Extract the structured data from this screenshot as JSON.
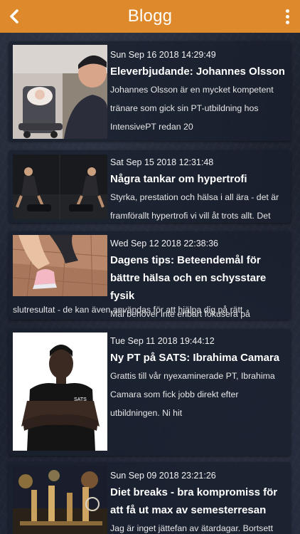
{
  "header": {
    "title": "Blogg",
    "back_icon": "chevron-left-icon",
    "menu_icon": "more-vertical-icon",
    "background_color": "#de8a2c"
  },
  "posts": [
    {
      "date": "Sun Sep 16 2018 14:29:49",
      "title": "Eleverbjudande: Johannes Olsson",
      "excerpt": "Johannes Olsson är en mycket kompetent tränare som gick sin PT-utbildning hos IntensivePT redan 20"
    },
    {
      "date": "Sat Sep 15 2018 12:31:48",
      "title": "Några tankar om hypertrofi",
      "excerpt": "Styrka, prestation och hälsa i all ära - det är framförallt hypertrofi vi vill åt trots allt. Det"
    },
    {
      "date": "Wed Sep 12 2018 22:38:36",
      "title": "Dagens tips: Beteendemål för bättre hälsa och en schysstare fysik",
      "excerpt_side": "Mål behöver inte enbart fokusera på",
      "excerpt_full": "slutresultat - de kan även användas för att hjälpa dig på rätt"
    },
    {
      "date": "Tue Sep 11 2018 19:44:12",
      "title": "Ny PT på SATS: Ibrahima Camara",
      "excerpt": "Grattis till vår nyexaminerade PT, Ibrahima Camara som fick jobb direkt efter utbildningen. Ni hit"
    },
    {
      "date": "Sun Sep 09 2018 23:21:26",
      "title": "Diet breaks - bra kompromiss för att få ut max av semesterresan",
      "excerpt": "Jag är inget jättefan av ätardagar. Bortsett"
    }
  ]
}
